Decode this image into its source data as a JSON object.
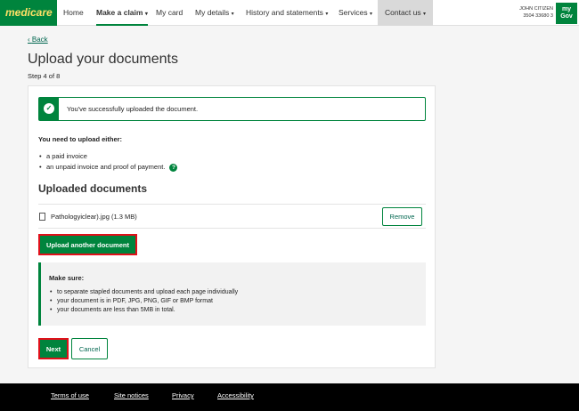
{
  "nav": {
    "brand": "medicare",
    "items": [
      {
        "label": "Home",
        "caret": false
      },
      {
        "label": "Make a claim",
        "caret": true
      },
      {
        "label": "My card",
        "caret": false
      },
      {
        "label": "My details",
        "caret": true
      },
      {
        "label": "History and statements",
        "caret": true
      },
      {
        "label": "Services",
        "caret": true
      },
      {
        "label": "Contact us",
        "caret": true
      }
    ],
    "user_name": "JOHN CITIZEN",
    "user_number": "3504 33680 3",
    "mygov_logo": "my Gov"
  },
  "page": {
    "back_link": "Back",
    "title": "Upload your documents",
    "step": "Step 4 of 8"
  },
  "alert": {
    "icon": "check-circle-icon",
    "message": "You've successfully uploaded the document."
  },
  "requirements": {
    "heading": "You need to upload either:",
    "items": [
      "a paid invoice",
      "an unpaid invoice and proof of payment."
    ],
    "help_icon": "?"
  },
  "uploaded": {
    "heading": "Uploaded documents",
    "files": [
      {
        "name": "Pathologyiclear).jpg (1.3 MB)",
        "remove_label": "Remove"
      }
    ],
    "upload_another_label": "Upload another document"
  },
  "make_sure": {
    "heading": "Make sure:",
    "items": [
      "to separate stapled documents and upload each page individually",
      "your document is in PDF, JPG, PNG, GIF or BMP format",
      "your documents are less than 5MB in total."
    ]
  },
  "actions": {
    "next_label": "Next",
    "cancel_label": "Cancel"
  },
  "footer": {
    "links": [
      "Terms of use",
      "Site notices",
      "Privacy",
      "Accessibility"
    ]
  },
  "colors": {
    "brand_green": "#00843d",
    "highlight_red": "#e0101a",
    "footer_bg": "#000000"
  }
}
